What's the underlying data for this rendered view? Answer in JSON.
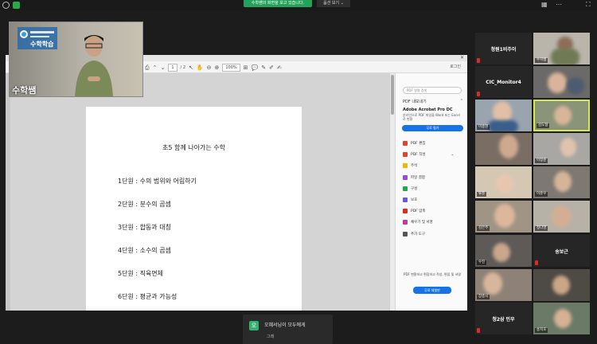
{
  "topbar": {
    "share_status": "수학쌤의 화면을 보고 있습니다.",
    "view_options": "옵션 보기 ⌄",
    "colors": {
      "share_badge": "#23a35a"
    }
  },
  "acrobat": {
    "page_current": "1",
    "page_total": "/ 2",
    "zoom": "100%",
    "login": "로그인",
    "search_placeholder": "PDF 명령 검색",
    "export_pdf": "PDF 내보내기",
    "product": "Adobe Acrobat Pro DC",
    "product_desc": "온라인으로 PDF 파일을 Word 또는 Excel로 변환",
    "free_trial": "무료 평가",
    "tools": [
      {
        "label": "PDF 편집",
        "color": "#e0452c"
      },
      {
        "label": "PDF 작성",
        "color": "#e0452c"
      },
      {
        "label": "주석",
        "color": "#f5b400"
      },
      {
        "label": "파일 결합",
        "color": "#9a4bd6"
      },
      {
        "label": "구성",
        "color": "#27a35a"
      },
      {
        "label": "보호",
        "color": "#6a5acd"
      },
      {
        "label": "PDF 압축",
        "color": "#d3301f"
      },
      {
        "label": "채우기 및 서명",
        "color": "#b83fa0"
      },
      {
        "label": "추가 도구",
        "color": "#555555"
      }
    ],
    "promo": "PDF 변환하고 편집하고 작성, 편집 및 서명",
    "trial_button": "무료 체험판"
  },
  "document": {
    "title": "초5 함께 나아가는 수학",
    "units": [
      "1단원 : 수의 범위와 어림하기",
      "2단원 : 분수의 곱셈",
      "3단원 : 합동과 대칭",
      "4단원 : 소수의 곱셈",
      "5단원 : 직육면체",
      "6단원 : 평균과 가능성"
    ]
  },
  "host": {
    "label": "수학쌤",
    "logo_text": "수학학습"
  },
  "gallery": [
    {
      "label": "청원1비주이",
      "type": "name"
    },
    {
      "label": "수학쌤",
      "type": "video"
    },
    {
      "label": "CIC_Monitor4",
      "type": "name"
    },
    {
      "label": "",
      "type": "video"
    },
    {
      "label": "이송현",
      "type": "video"
    },
    {
      "label": "김도형",
      "type": "video"
    },
    {
      "label": "",
      "type": "video"
    },
    {
      "label": "아창준",
      "type": "video"
    },
    {
      "label": "류준",
      "type": "video"
    },
    {
      "label": "이준우",
      "type": "video"
    },
    {
      "label": "김은주",
      "type": "video"
    },
    {
      "label": "정다영",
      "type": "video"
    },
    {
      "label": "우진",
      "type": "video"
    },
    {
      "label": "송보근",
      "type": "name"
    },
    {
      "label": "장송시",
      "type": "video"
    },
    {
      "label": "",
      "type": "video"
    },
    {
      "label": "청2삼 민우",
      "type": "name"
    },
    {
      "label": "송지호",
      "type": "video"
    }
  ],
  "chat": {
    "avatar": "오",
    "from": "오혜서님이 모두에게",
    "message": "그래"
  }
}
